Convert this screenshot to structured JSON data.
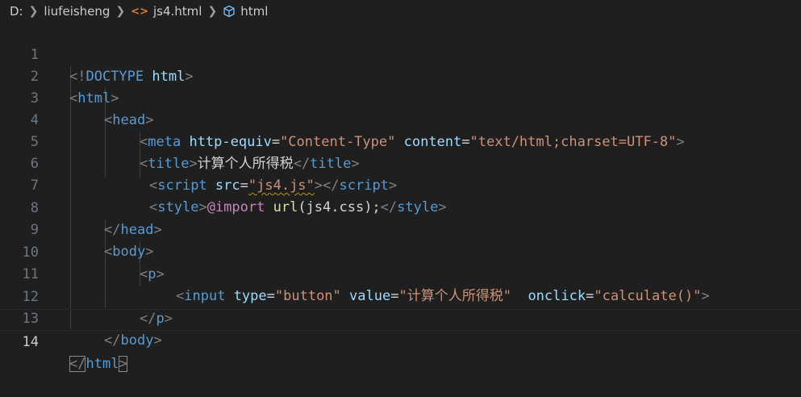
{
  "breadcrumb": {
    "drive": "D:",
    "folder": "liufeisheng",
    "file": "js4.html",
    "symbol": "html"
  },
  "icons": {
    "separator": "chevron-right-icon",
    "file": "html-file-icon",
    "symbol": "symbol-class-icon"
  },
  "lines": [
    {
      "n": "1",
      "t": {
        "a": "<!",
        "b": "DOCTYPE",
        "c": " html",
        "d": ">"
      }
    },
    {
      "n": "2",
      "t": {
        "a": "<",
        "b": "html",
        "c": ">"
      }
    },
    {
      "n": "3",
      "t": {
        "a": "<",
        "b": "head",
        "c": ">"
      }
    },
    {
      "n": "4",
      "t": {
        "a": "<",
        "b": "meta",
        "c": " ",
        "d": "http-equiv",
        "e": "=",
        "f": "\"Content-Type\"",
        "g": " ",
        "h": "content",
        "i": "=",
        "j": "\"text/html;charset=UTF-8\"",
        "k": ">"
      }
    },
    {
      "n": "5",
      "t": {
        "a": "<",
        "b": "title",
        "c": ">",
        "d": "计算个人所得税",
        "e": "</",
        "f": "title",
        "g": ">"
      }
    },
    {
      "n": "6",
      "t": {
        "a": "<",
        "b": "script",
        "c": " ",
        "d": "src",
        "e": "=",
        "f": "\"js4.js\"",
        "g": "></",
        "h": "script",
        "i": ">"
      }
    },
    {
      "n": "7",
      "t": {
        "a": "<",
        "b": "style",
        "c": ">",
        "d": "@import",
        "e": " ",
        "f": "url",
        "g": "(js4.css);",
        "h": "</",
        "i": "style",
        "j": ">"
      }
    },
    {
      "n": "8",
      "t": {
        "a": "</",
        "b": "head",
        "c": ">"
      }
    },
    {
      "n": "9",
      "t": {
        "a": "<",
        "b": "body",
        "c": ">"
      }
    },
    {
      "n": "10",
      "t": {
        "a": "<",
        "b": "p",
        "c": ">"
      }
    },
    {
      "n": "11",
      "t": {
        "a": "<",
        "b": "input",
        "c": " ",
        "d": "type",
        "e": "=",
        "f": "\"button\"",
        "g": " ",
        "h": "value",
        "i": "=",
        "j": "\"计算个人所得税\"",
        "k": "  ",
        "l": "onclick",
        "m": "=",
        "n": "\"calculate()\"",
        "o": ">"
      }
    },
    {
      "n": "12",
      "t": {
        "a": "</",
        "b": "p",
        "c": ">"
      }
    },
    {
      "n": "13",
      "t": {
        "a": "</",
        "b": "body",
        "c": ">"
      }
    },
    {
      "n": "14",
      "t": {
        "a": "</",
        "b": "html",
        "c": ">"
      }
    }
  ],
  "colors": {
    "background": "#1f1f1f",
    "tag": "#569cd6",
    "attribute": "#9cdcfe",
    "string": "#ce9178",
    "keyword": "#c586c0",
    "line_number": "#6e7681"
  }
}
